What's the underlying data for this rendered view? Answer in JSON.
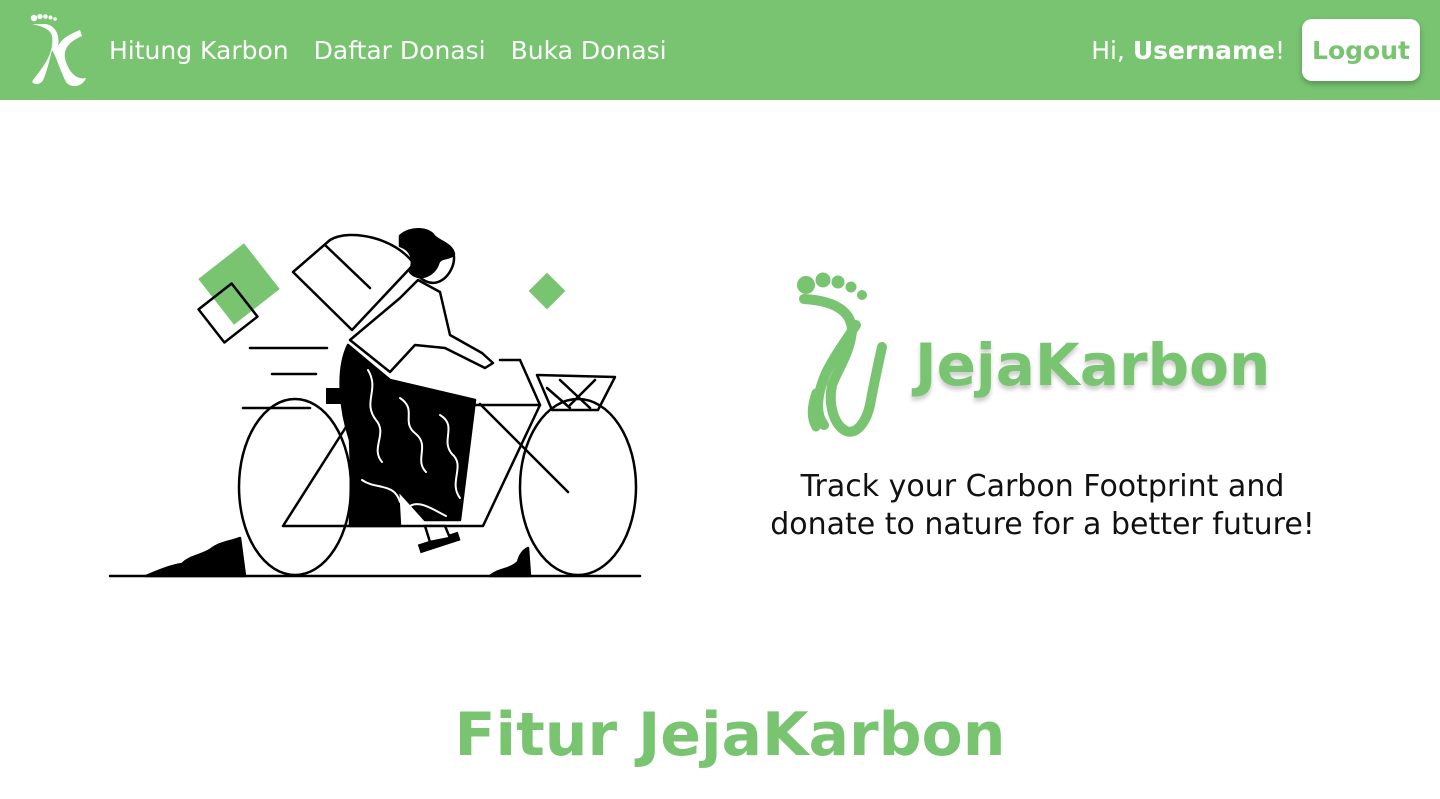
{
  "colors": {
    "brand_green": "#78c471",
    "white": "#ffffff",
    "text": "#111111"
  },
  "navbar": {
    "logo_icon": "jejakarbon-footprint-logo",
    "links": [
      {
        "label": "Hitung Karbon"
      },
      {
        "label": "Daftar Donasi"
      },
      {
        "label": "Buka Donasi"
      }
    ],
    "greeting_prefix": "Hi, ",
    "username": "Username",
    "greeting_suffix": "!",
    "logout_label": "Logout"
  },
  "hero": {
    "illustration_icon": "cyclist-illustration",
    "brand_icon": "footprint-icon",
    "brand_name": "JejaKarbon",
    "tagline_line1": "Track your Carbon Footprint and",
    "tagline_line2": "donate to nature for a better future!"
  },
  "features": {
    "title": "Fitur JejaKarbon"
  }
}
